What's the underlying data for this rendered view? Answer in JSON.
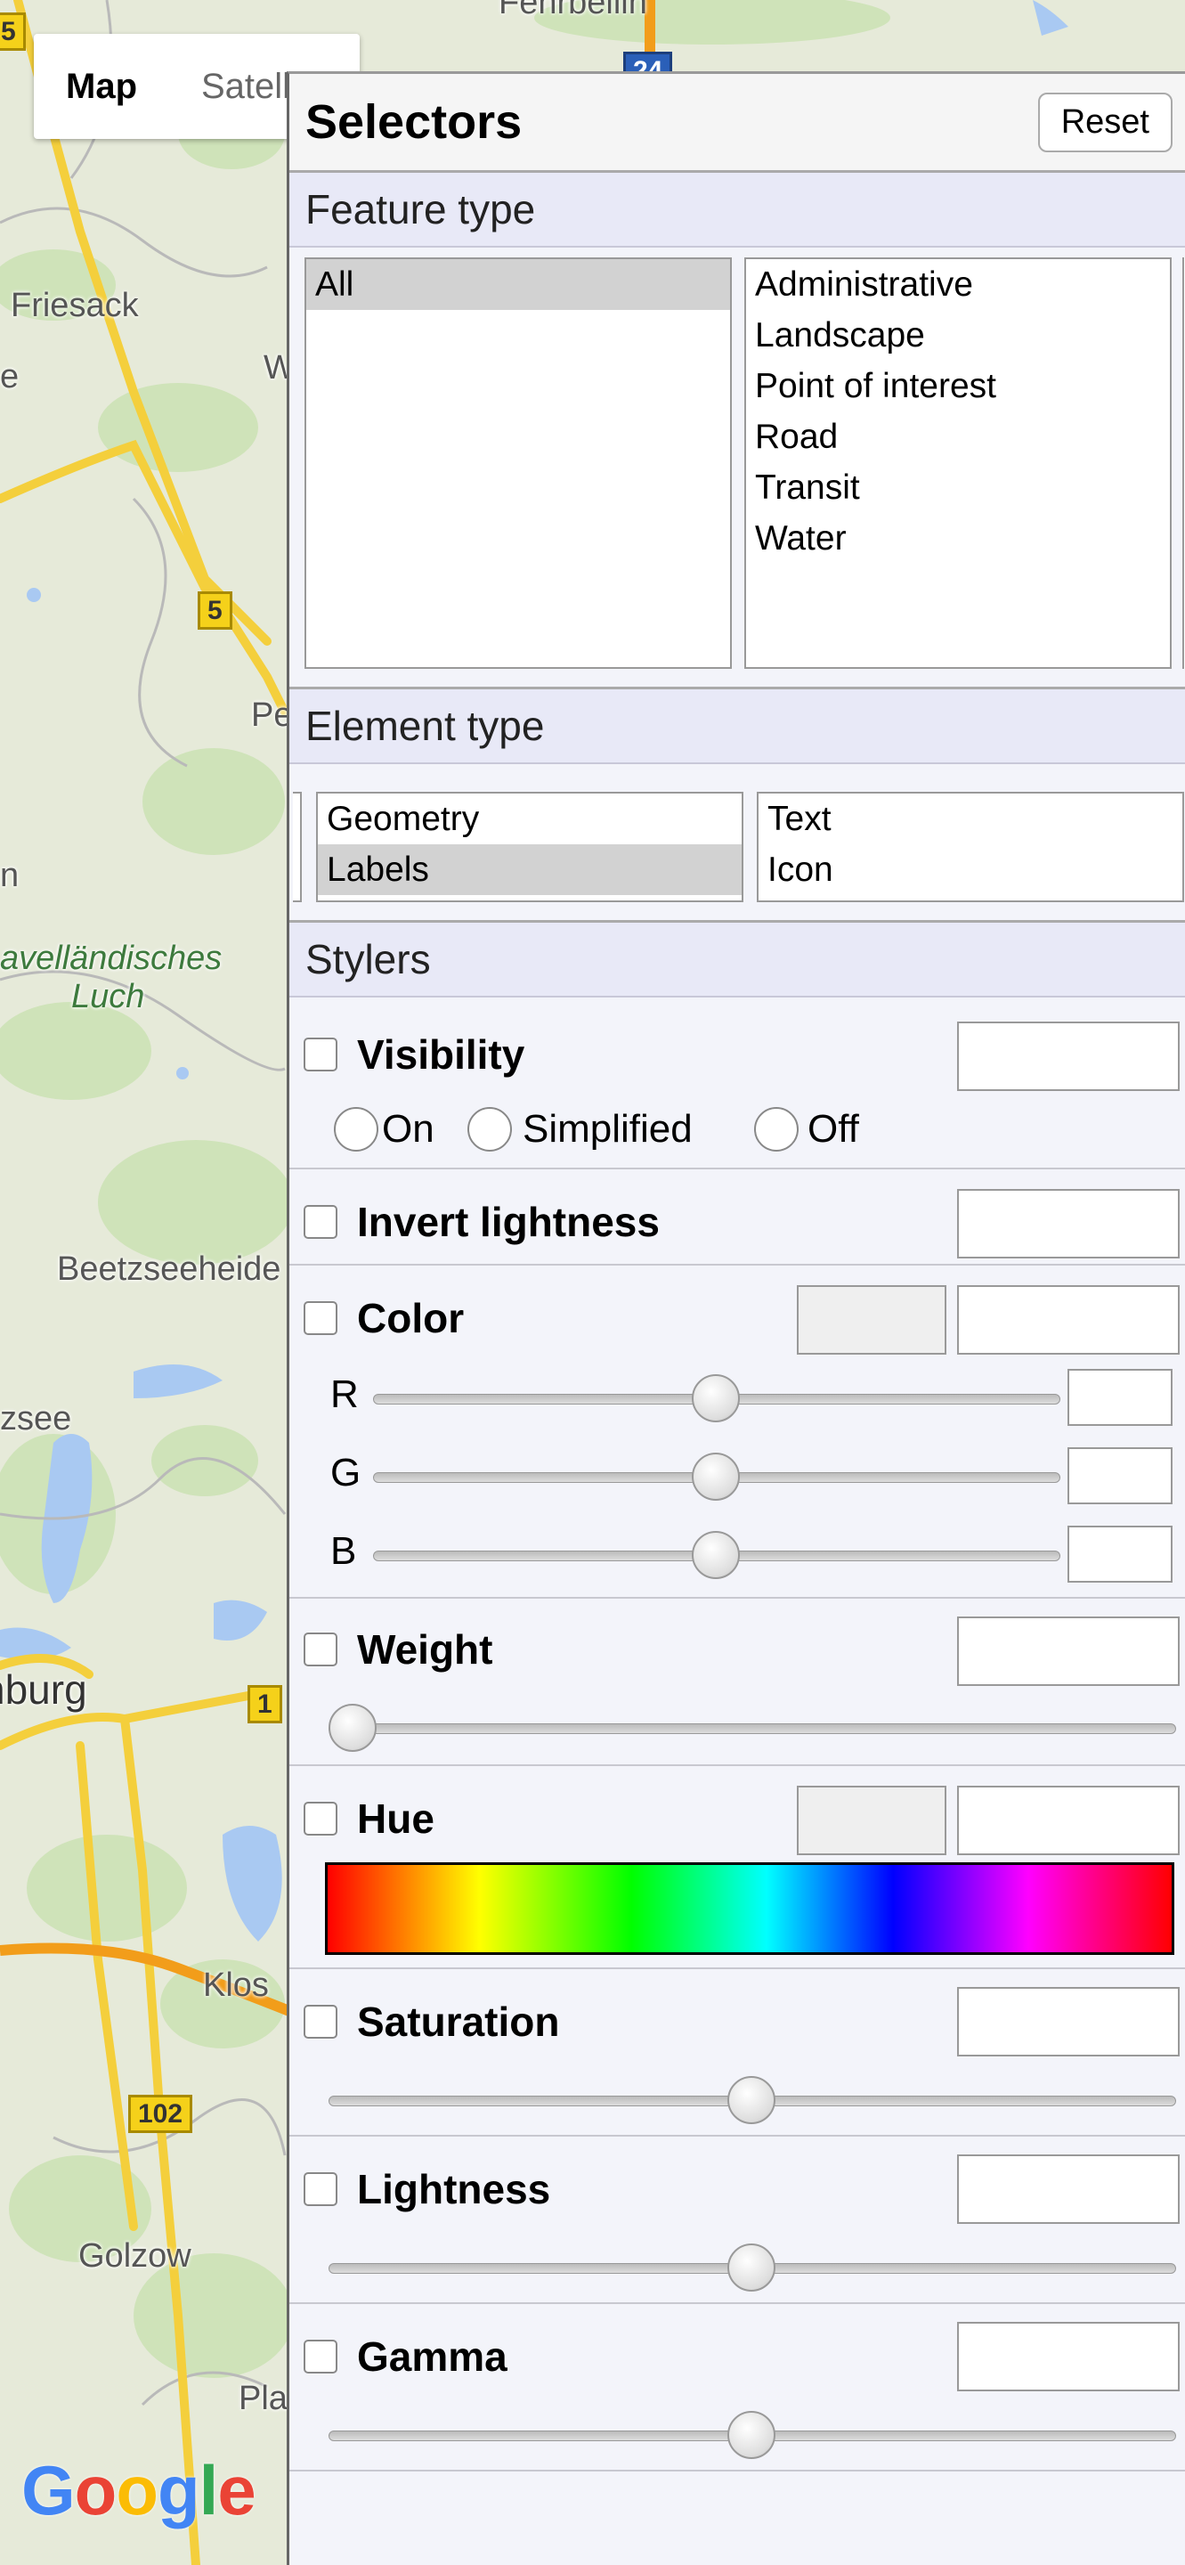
{
  "map": {
    "type_control": {
      "map_label": "Map",
      "satellite_label": "Satellite"
    },
    "labels": {
      "top_town": "Fehrbellin",
      "friesack": "Friesack",
      "left_e": "e",
      "left_w": "W",
      "pe": "Pe",
      "n": "n",
      "havel1": "avelländisches",
      "havel2": "Luch",
      "beetz": "Beetzseeheide",
      "zsee": "zsee",
      "burg": "nburg",
      "klos": "Klos",
      "golzow": "Golzow",
      "pla": "Pla"
    },
    "shields": {
      "s5a": "5",
      "s5b": "5",
      "s24": "24",
      "s1": "1",
      "s102": "102"
    },
    "logo": [
      "G",
      "o",
      "o",
      "g",
      "l",
      "e"
    ]
  },
  "panel": {
    "title": "Selectors",
    "reset_label": "Reset",
    "feature_type": {
      "heading": "Feature type",
      "col1": [
        "All"
      ],
      "col1_selected": "All",
      "col2": [
        "Administrative",
        "Landscape",
        "Point of interest",
        "Road",
        "Transit",
        "Water"
      ]
    },
    "element_type": {
      "heading": "Element type",
      "col1": [
        "Geometry",
        "Labels"
      ],
      "col1_selected": "Labels",
      "col2": [
        "Text",
        "Icon"
      ]
    },
    "stylers": {
      "heading": "Stylers",
      "visibility": {
        "label": "Visibility",
        "options": [
          "On",
          "Simplified",
          "Off"
        ]
      },
      "invert": {
        "label": "Invert lightness"
      },
      "color": {
        "label": "Color",
        "channels": [
          "R",
          "G",
          "B"
        ],
        "levels": [
          0.5,
          0.5,
          0.5
        ]
      },
      "weight": {
        "label": "Weight",
        "level": 0.0
      },
      "hue": {
        "label": "Hue"
      },
      "saturation": {
        "label": "Saturation",
        "level": 0.5
      },
      "lightness": {
        "label": "Lightness",
        "level": 0.5
      },
      "gamma": {
        "label": "Gamma",
        "level": 0.5
      }
    }
  }
}
